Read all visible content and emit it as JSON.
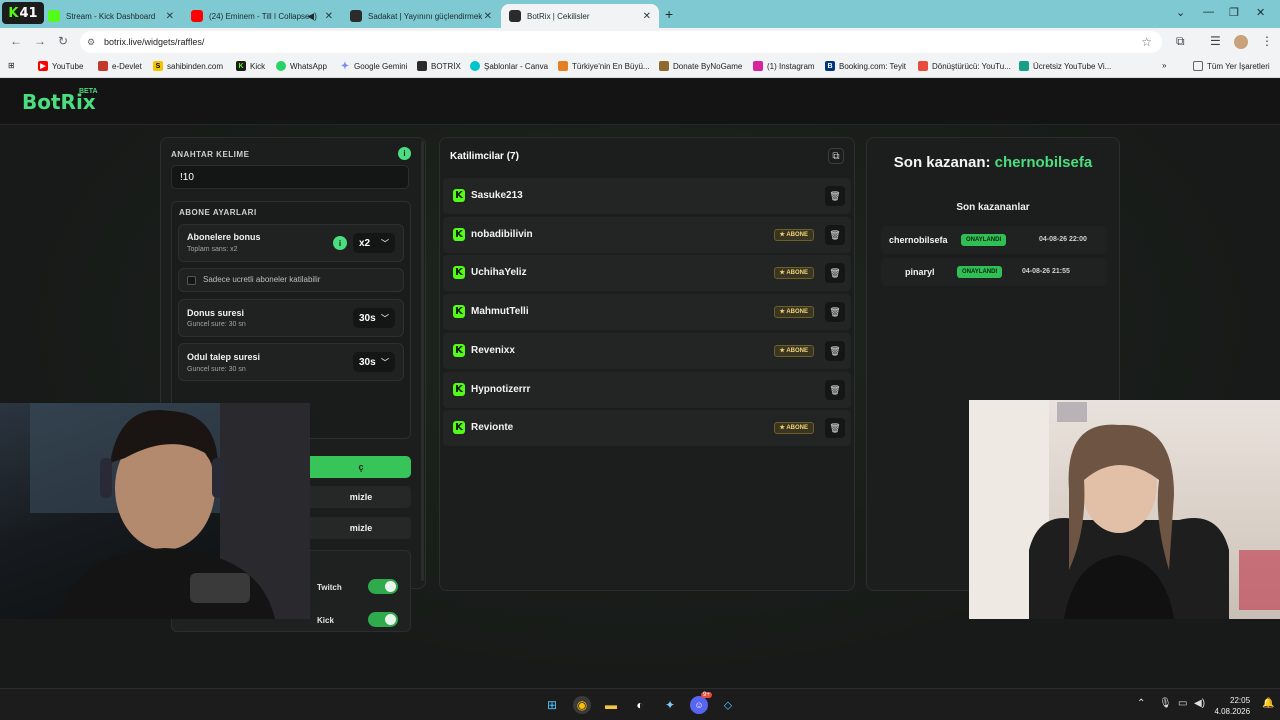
{
  "browser": {
    "tab_counter": "41",
    "tabs": [
      {
        "title": "Stream - Kick Dashboard",
        "close": "✕"
      },
      {
        "title": "(24) Eminem - Till I Collapse",
        "close": "✕"
      },
      {
        "title": "Sadakat | Yayınını güçlendirmek",
        "close": "✕"
      },
      {
        "title": "BotRix | Cekilisler",
        "close": "✕"
      }
    ],
    "url": "botrix.live/widgets/raffles/",
    "bookmarks": [
      "YouTube",
      "e-Devlet",
      "sahibinden.com",
      "Kick",
      "WhatsApp",
      "Google Gemini",
      "BOTRİX",
      "Şablonlar - Canva",
      "Türkiye'nin En Büyü...",
      "Donate ByNoGame",
      "(1) Instagram",
      "Booking.com: Teyit",
      "Dönüştürücü: YouTu...",
      "Ücretsiz YouTube Vi...",
      "»",
      "Tüm Yer İşaretleri"
    ]
  },
  "site": {
    "logo": "BotRix",
    "beta": "BETA"
  },
  "settings": {
    "keyword_label": "ANAHTAR KELIME",
    "keyword_value": "!10",
    "sub_section_label": "ABONE AYARLARI",
    "bonus_title": "Abonelere bonus",
    "bonus_sub": "Toplam sans: x2",
    "bonus_value": "x2",
    "only_paid_label": "Sadece ucretli aboneler katilabilir",
    "bonus_time_title": "Donus suresi",
    "bonus_time_sub": "Guncel sure: 30 sn",
    "bonus_time_value": "30s",
    "claim_time_title": "Odul talep suresi",
    "claim_time_sub": "Guncel sure: 30 sn",
    "claim_time_value": "30s",
    "pick_button": "ç",
    "clear_button_1": "mizle",
    "clear_button_2": "mizle",
    "platform_twitch": "Twitch",
    "platform_kick": "Kick"
  },
  "participants": {
    "title": "Katilimcilar (7)",
    "badge_label": "★ ABONE",
    "items": [
      {
        "name": "Sasuke213",
        "subscriber": false
      },
      {
        "name": "nobadibilivin",
        "subscriber": true
      },
      {
        "name": "UchihaYeliz",
        "subscriber": true
      },
      {
        "name": "MahmutTelli",
        "subscriber": true
      },
      {
        "name": "Revenixx",
        "subscriber": true
      },
      {
        "name": "Hypnotizerrr",
        "subscriber": false
      },
      {
        "name": "Revionte",
        "subscriber": true
      }
    ]
  },
  "winners": {
    "last_label": "Son kazanan:",
    "last_name": "chernobilsefa",
    "recent_label": "Son kazananlar",
    "items": [
      {
        "name": "chernobilsefa",
        "status": "ONAYLANDI",
        "time": "04-08-26 22:00"
      },
      {
        "name": "pinaryl",
        "status": "ONAYLANDI",
        "time": "04-08-26 21:55"
      }
    ]
  },
  "taskbar": {
    "time": "22:05",
    "date": "4.08.2026",
    "discord_badge": "9+"
  },
  "colors": {
    "accent": "#4ade80",
    "kick": "#53fc18",
    "tabbar": "#7ec9d2"
  }
}
